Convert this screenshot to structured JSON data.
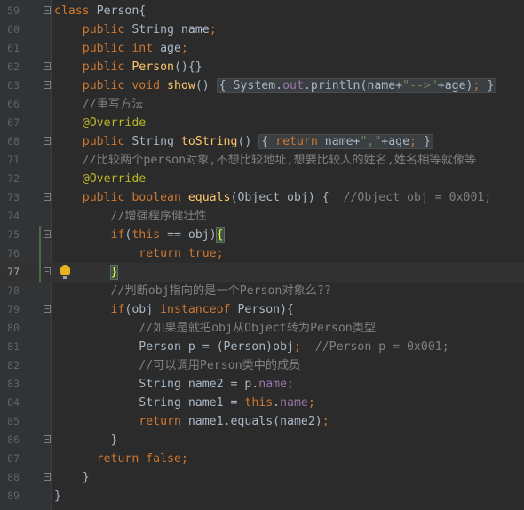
{
  "editor": {
    "lines": [
      {
        "num": "59",
        "tokens": [
          {
            "t": "class ",
            "c": "kw"
          },
          {
            "t": "Person{",
            "c": "pl"
          }
        ]
      },
      {
        "num": "60",
        "tokens": [
          {
            "t": "    public ",
            "c": "kw"
          },
          {
            "t": "String name",
            "c": "pl"
          },
          {
            "t": ";",
            "c": "kw"
          }
        ]
      },
      {
        "num": "61",
        "tokens": [
          {
            "t": "    public int ",
            "c": "kw"
          },
          {
            "t": "age",
            "c": "pl"
          },
          {
            "t": ";",
            "c": "kw"
          }
        ]
      },
      {
        "num": "62",
        "tokens": [
          {
            "t": "    public ",
            "c": "kw"
          },
          {
            "t": "Person",
            "c": "mt"
          },
          {
            "t": "(){}",
            "c": "pl"
          }
        ]
      },
      {
        "num": "63",
        "tokens": [
          {
            "t": "    public void ",
            "c": "kw"
          },
          {
            "t": "show",
            "c": "mt"
          },
          {
            "t": "() ",
            "c": "pl"
          },
          {
            "t": "{ ",
            "c": "pl",
            "box": "start"
          },
          {
            "t": "System.",
            "c": "pl"
          },
          {
            "t": "out",
            "c": "fd"
          },
          {
            "t": ".println(name+",
            "c": "pl"
          },
          {
            "t": "\"-->\"",
            "c": "st"
          },
          {
            "t": "+age)",
            "c": "pl"
          },
          {
            "t": ";",
            "c": "kw"
          },
          {
            "t": " }",
            "c": "pl",
            "box": "end"
          }
        ]
      },
      {
        "num": "66",
        "tokens": [
          {
            "t": "    //重写方法",
            "c": "cm"
          }
        ]
      },
      {
        "num": "67",
        "tokens": [
          {
            "t": "    @Override",
            "c": "an"
          }
        ]
      },
      {
        "num": "68",
        "tokens": [
          {
            "t": "    public ",
            "c": "kw"
          },
          {
            "t": "String ",
            "c": "pl"
          },
          {
            "t": "toString",
            "c": "mt"
          },
          {
            "t": "() ",
            "c": "pl"
          },
          {
            "t": "{ ",
            "c": "pl",
            "box": "start"
          },
          {
            "t": "return ",
            "c": "kw"
          },
          {
            "t": "name+",
            "c": "pl"
          },
          {
            "t": "\",\"",
            "c": "st"
          },
          {
            "t": "+age",
            "c": "pl"
          },
          {
            "t": ";",
            "c": "kw"
          },
          {
            "t": " }",
            "c": "pl",
            "box": "end"
          }
        ]
      },
      {
        "num": "71",
        "tokens": [
          {
            "t": "    //比较两个person对象,不想比较地址,想要比较人的姓名,姓名相等就像等",
            "c": "cm"
          }
        ]
      },
      {
        "num": "72",
        "tokens": [
          {
            "t": "    @Override",
            "c": "an"
          }
        ]
      },
      {
        "num": "73",
        "tokens": [
          {
            "t": "    public boolean ",
            "c": "kw"
          },
          {
            "t": "equals",
            "c": "mt"
          },
          {
            "t": "(Object obj) {  ",
            "c": "pl"
          },
          {
            "t": "//Object obj = 0x001;",
            "c": "cm"
          }
        ]
      },
      {
        "num": "74",
        "tokens": [
          {
            "t": "        //增强程序健壮性",
            "c": "cm"
          }
        ]
      },
      {
        "num": "75",
        "tokens": [
          {
            "t": "        if",
            "c": "kw"
          },
          {
            "t": "(",
            "c": "pl"
          },
          {
            "t": "this ",
            "c": "kw"
          },
          {
            "t": "== obj)",
            "c": "pl"
          },
          {
            "t": "{",
            "c": "pl",
            "hl": true
          }
        ]
      },
      {
        "num": "76",
        "tokens": [
          {
            "t": "            return true",
            "c": "kw"
          },
          {
            "t": ";",
            "c": "kw"
          }
        ]
      },
      {
        "num": "77",
        "tokens": [
          {
            "t": "        ",
            "c": "pl"
          },
          {
            "t": "}",
            "c": "pl",
            "hl": true
          }
        ]
      },
      {
        "num": "78",
        "tokens": [
          {
            "t": "        //判断obj指向的是一个Person对象么??",
            "c": "cm"
          }
        ]
      },
      {
        "num": "79",
        "tokens": [
          {
            "t": "        if",
            "c": "kw"
          },
          {
            "t": "(obj ",
            "c": "pl"
          },
          {
            "t": "instanceof ",
            "c": "kw"
          },
          {
            "t": "Person){",
            "c": "pl"
          }
        ]
      },
      {
        "num": "80",
        "tokens": [
          {
            "t": "            //如果是就把obj从Object转为Person类型",
            "c": "cm"
          }
        ]
      },
      {
        "num": "81",
        "tokens": [
          {
            "t": "            Person p = (Person)obj",
            "c": "pl"
          },
          {
            "t": ";  ",
            "c": "kw"
          },
          {
            "t": "//Person p = 0x001;",
            "c": "cm"
          }
        ]
      },
      {
        "num": "82",
        "tokens": [
          {
            "t": "            //可以调用Person类中的成员",
            "c": "cm"
          }
        ]
      },
      {
        "num": "83",
        "tokens": [
          {
            "t": "            String name2 = p.",
            "c": "pl"
          },
          {
            "t": "name",
            "c": "fd"
          },
          {
            "t": ";",
            "c": "kw"
          }
        ]
      },
      {
        "num": "84",
        "tokens": [
          {
            "t": "            String name1 = ",
            "c": "pl"
          },
          {
            "t": "this",
            "c": "kw"
          },
          {
            "t": ".",
            "c": "pl"
          },
          {
            "t": "name",
            "c": "fd"
          },
          {
            "t": ";",
            "c": "kw"
          }
        ]
      },
      {
        "num": "85",
        "tokens": [
          {
            "t": "            return ",
            "c": "kw"
          },
          {
            "t": "name1.equals(name2)",
            "c": "pl"
          },
          {
            "t": ";",
            "c": "kw"
          }
        ]
      },
      {
        "num": "86",
        "tokens": [
          {
            "t": "        }",
            "c": "pl"
          }
        ]
      },
      {
        "num": "87",
        "tokens": [
          {
            "t": "      return false",
            "c": "kw"
          },
          {
            "t": ";",
            "c": "kw"
          }
        ]
      },
      {
        "num": "88",
        "tokens": [
          {
            "t": "    }",
            "c": "pl"
          }
        ]
      },
      {
        "num": "89",
        "tokens": [
          {
            "t": "}",
            "c": "pl"
          }
        ]
      }
    ],
    "current_line": "77",
    "fold_marker_lines": [
      "59",
      "62",
      "63",
      "68",
      "73",
      "75",
      "77",
      "79",
      "86",
      "88"
    ],
    "intention_bulb_line": "77",
    "colors": {
      "background": "#2b2b2b",
      "gutter": "#313335",
      "keyword": "#cc7832",
      "method": "#ffc66d",
      "string": "#6a8759",
      "comment": "#808080",
      "annotation": "#bbb529",
      "field": "#9876aa",
      "plain": "#a9b7c6",
      "line_number": "#606366"
    }
  }
}
